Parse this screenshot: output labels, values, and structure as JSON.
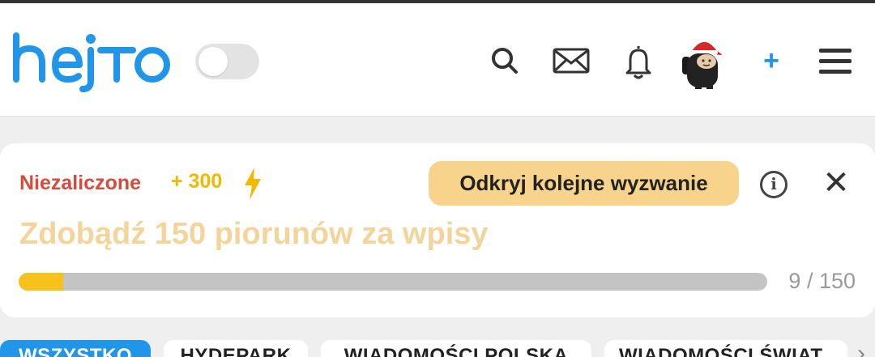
{
  "app": {
    "logo_text": "hejto",
    "brand_color": "#2196e8"
  },
  "header": {
    "theme_toggle_state": "off",
    "icons": [
      "search-icon",
      "mail-icon",
      "bell-icon",
      "avatar",
      "plus-icon",
      "menu-icon"
    ],
    "plus_label": "+"
  },
  "challenge": {
    "status": "Niezaliczone",
    "points": "+ 300",
    "cta_label": "Odkryj kolejne wyzwanie",
    "info_label": "i",
    "close_label": "✕",
    "title": "Zdobądź 150 piorunów za wpisy",
    "progress_current": 9,
    "progress_total": 150,
    "progress_text": "9 / 150",
    "colors": {
      "status": "#d9493c",
      "points": "#f5b800",
      "title": "#f3d59c",
      "cta_bg": "#f7d38b",
      "bar_fill": "#f7c21c",
      "bar_track": "#c4c4c4"
    }
  },
  "tabs": {
    "items": [
      "WSZYSTKO",
      "HYDEPARK",
      "WIADOMOŚCI POLSKA",
      "WIADOMOŚCI ŚWIAT"
    ],
    "active": "WSZYSTKO",
    "more_label": "›"
  }
}
